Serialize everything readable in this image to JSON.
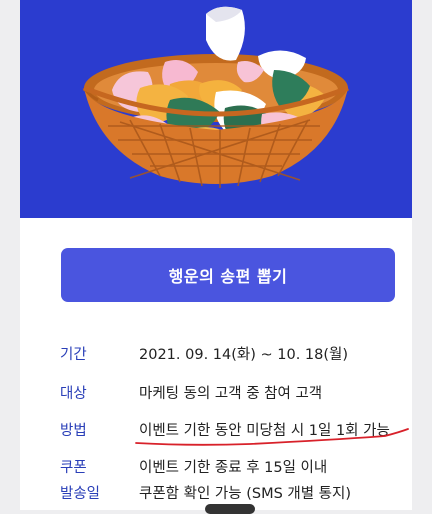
{
  "colors": {
    "hero_background": "#2b3ccf",
    "button_background": "#4a55df",
    "label_text": "#2a3fb8",
    "value_text": "#222222",
    "annotation_underline": "#d8212a"
  },
  "hero": {
    "illustration": "songpyeon-basket-illustration"
  },
  "cta": {
    "label": "행운의 송편 뽑기"
  },
  "event_info": [
    {
      "label": "기간",
      "value": "2021. 09. 14(화) ~ 10. 18(월)"
    },
    {
      "label": "대상",
      "value": "마케팅 동의 고객 중 참여 고객"
    },
    {
      "label": "방법",
      "value": "이벤트 기한 동안 미당첨 시 1일 1회 가능"
    },
    {
      "label": "쿠폰",
      "value": "이벤트 기한 종료 후 15일 이내"
    },
    {
      "label": "발송일",
      "value": "쿠폰함 확인 가능 (SMS 개별 통지)"
    }
  ]
}
